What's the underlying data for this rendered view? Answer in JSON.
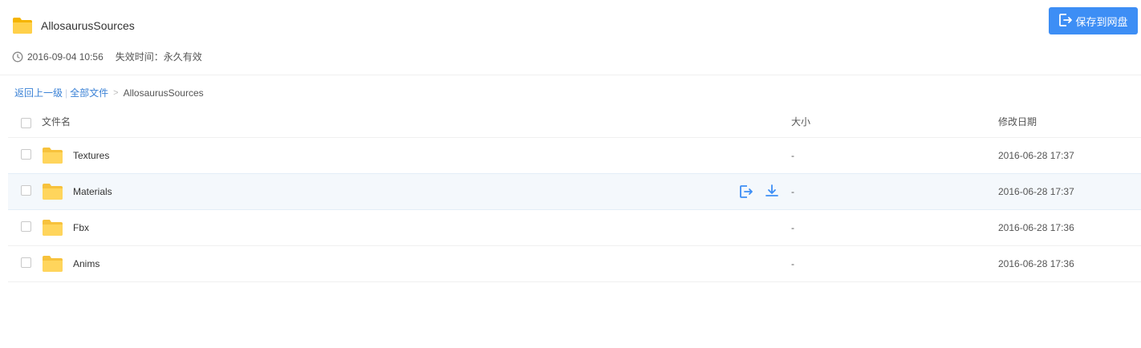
{
  "header": {
    "title": "AllosaurusSources",
    "save_label": "保存到网盘",
    "date": "2016-09-04 10:56",
    "expire_label": "失效时间：永久有效"
  },
  "breadcrumb": {
    "back_label": "返回上一级",
    "separator": "|",
    "all_files_label": "全部文件",
    "arrow": ">",
    "current": "AllosaurusSources"
  },
  "table": {
    "columns": {
      "name": "文件名",
      "size": "大小",
      "modified": "修改日期"
    },
    "rows": [
      {
        "name": "Textures",
        "size": "-",
        "modified": "2016-06-28 17:37"
      },
      {
        "name": "Materials",
        "size": "-",
        "modified": "2016-06-28 17:37"
      },
      {
        "name": "Fbx",
        "size": "-",
        "modified": "2016-06-28 17:36"
      },
      {
        "name": "Anims",
        "size": "-",
        "modified": "2016-06-28 17:36"
      }
    ]
  },
  "colors": {
    "accent": "#3d8ef5",
    "link": "#3b82d6",
    "folder": "#ffd55c"
  },
  "icons": {
    "folder": "folder-icon",
    "clock": "clock-icon",
    "save": "save-to-drive-icon",
    "download": "download-icon"
  }
}
